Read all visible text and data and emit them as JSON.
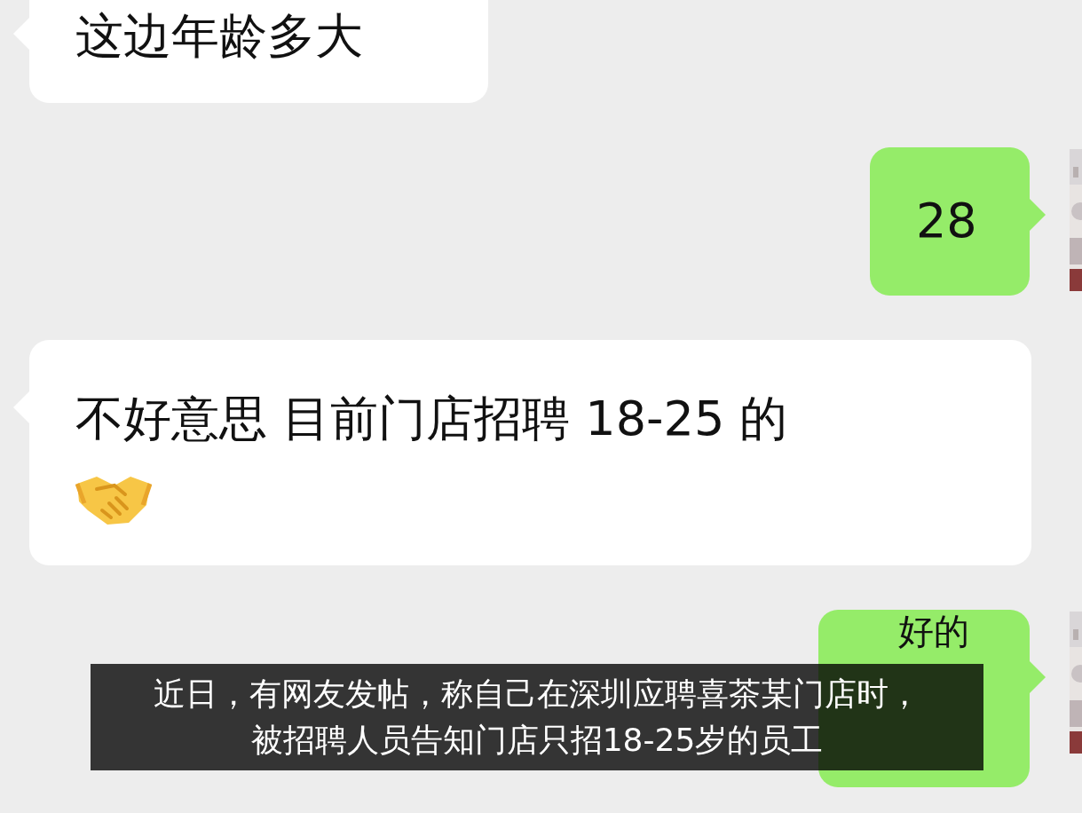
{
  "messages": [
    {
      "kind": "incoming",
      "text": "这边年龄多大"
    },
    {
      "kind": "outgoing",
      "text": "28"
    },
    {
      "kind": "incoming",
      "text": "不好意思 目前门店招聘 18-25 的",
      "attachments": [
        {
          "kind": "emoji"
        }
      ]
    },
    {
      "kind": "outgoing",
      "text": "好的"
    }
  ],
  "subtitle": {
    "lines": [
      "近日，有网友发帖，称自己在深圳应聘喜茶某门店时，",
      "被招聘人员告知门店只招18-25岁的员工"
    ]
  }
}
